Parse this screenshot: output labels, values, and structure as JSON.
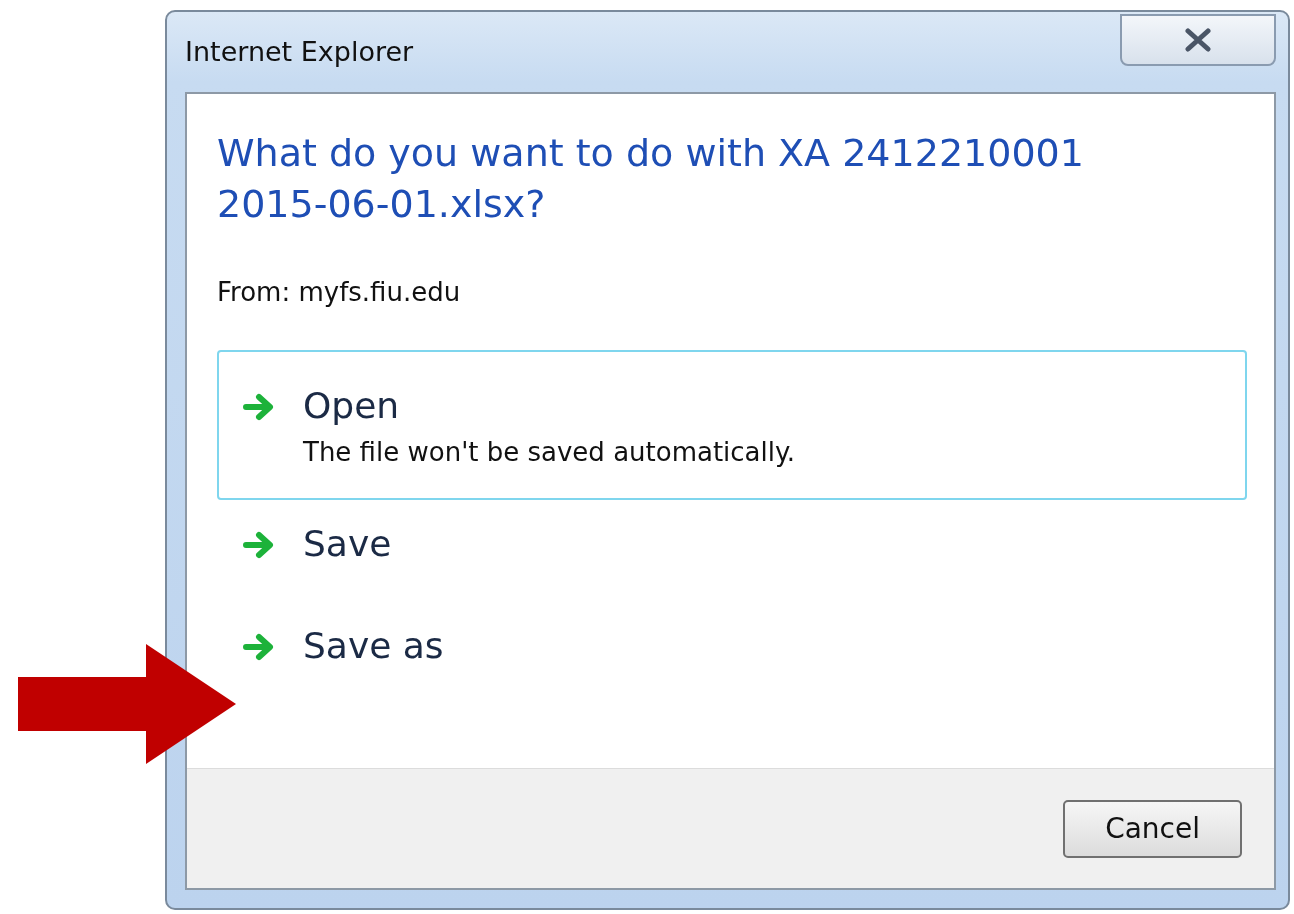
{
  "window": {
    "title": "Internet Explorer"
  },
  "heading": "What do you want to do with XA 2412210001 2015-06-01.xlsx?",
  "source": "From: myfs.fiu.edu",
  "options": [
    {
      "label": "Open",
      "description": "The file won't be saved automatically.",
      "selected": true
    },
    {
      "label": "Save",
      "selected": false
    },
    {
      "label": "Save as",
      "selected": false
    }
  ],
  "buttons": [
    {
      "label": "Cancel"
    }
  ]
}
